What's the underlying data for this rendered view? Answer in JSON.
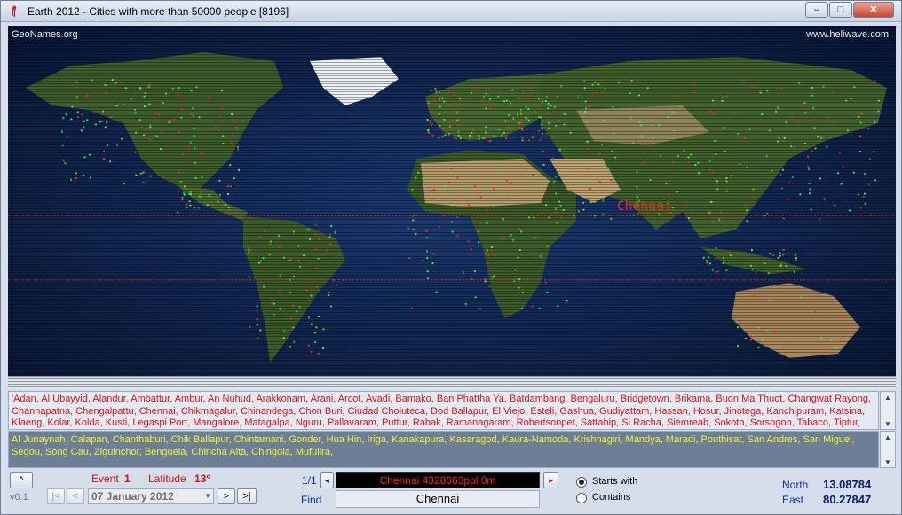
{
  "window": {
    "title": "Earth 2012 - Cities with more than 50000 people [8196]",
    "min_glyph": "–",
    "max_glyph": "□",
    "close_glyph": "✕"
  },
  "map": {
    "credit_left": "GeoNames.org",
    "credit_right": "www.heliwave.com",
    "highlight_city": "Chennai"
  },
  "lists": {
    "matches_text": "'Adan, Al Ubayyid, Alandur, Ambattur, Ambur, An Nuhud, Arakkonam, Arani, Arcot, Avadi, Bamako, Ban Phattha Ya, Batdambang, Bengaluru, Bridgetown, Brikama, Buon Ma Thuot, Changwat Rayong, Channapatna, Chengalpattu, Chennai, Chikmagalur, Chinandega, Chon Buri, Ciudad Choluteca, Dod Ballapur, El Viejo, Esteli, Gashua, Gudiyattam, Hassan, Hosur, Jinotega, Kanchipuram, Katsina, Klaeng, Kolar, Kolda, Kusti, Legaspi Port, Mangalore, Matagalpa, Nguru, Pallavaram, Puttur, Rabak, Ramanagaram, Robertsonpet, Sattahip, Si Racha, Siemreab, Sokoto, Sorsogon, Tabaco, Tiptur, Tumkur, Tuy Hoa,",
    "others_text": "Al Junaynah, Calapan, Chanthaburi, Chik Ballapur, Chintamani, Gonder, Hua Hin, Iriga, Kanakapura, Kasaragod, Kaura-Namoda, Krishnagiri, Mandya, Maradi, Pouthisat, San Andres, San Miguel, Segou, Song Cau, Ziguinchor, Benguela, Chincha Alta, Chingola, Mufulira,"
  },
  "controls": {
    "collapse_glyph": "^",
    "event_label": "Event",
    "event_value": "1",
    "latitude_label": "Latitude",
    "latitude_value": "13°",
    "version": "v0.1",
    "first_glyph": "|<",
    "prev_glyph": "<",
    "date_value": "07  January  2012",
    "next_glyph": ">",
    "last_glyph": ">|",
    "page_indicator": "1/1",
    "scroll_left_glyph": "◂",
    "scroll_right_glyph": "▸",
    "status_text": "Chennai   4328063ppl   0m",
    "find_label": "Find",
    "search_value": "Chennai",
    "radio_starts_with": "Starts with",
    "radio_contains": "Contains",
    "north_label": "North",
    "north_value": "13.08784",
    "east_label": "East",
    "east_value": "80.27847"
  },
  "colors": {
    "ocean": "#0c1f4a",
    "land": "#3d5a2a",
    "desert": "#b59a6a",
    "ice": "#f2f5f8",
    "city_dot_green": "#3cf53c",
    "city_dot_red": "#ff2a2a",
    "latitude_line": "#ff3030"
  }
}
